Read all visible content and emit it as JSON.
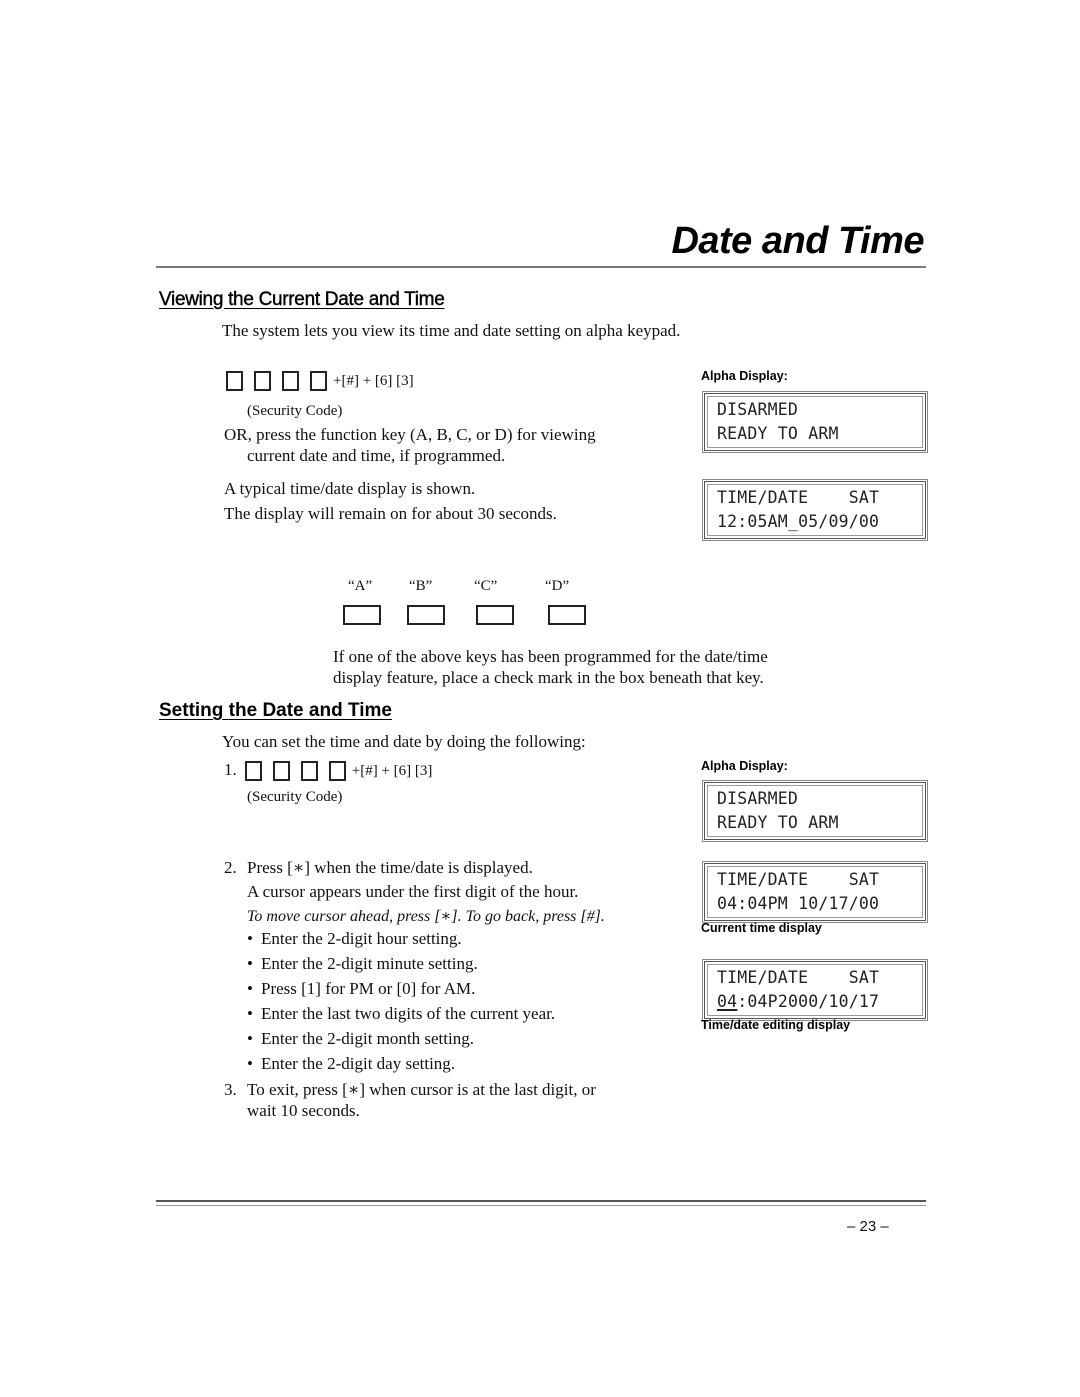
{
  "page": {
    "title": "Date and Time",
    "page_number": "– 23 –"
  },
  "viewing": {
    "heading": "Viewing the Current Date and Time",
    "intro": "The system lets you view its time and date setting on alpha keypad.",
    "key_sequence": "+[#] + [6] [3]",
    "security_code_label": "(Security Code)",
    "or_line_1": "OR, press the function key (A, B, C, or D) for viewing",
    "or_line_2": "current date and time, if programmed.",
    "typical_display": "A typical time/date display is shown.",
    "remain_on": "The display will remain on for about 30 seconds.",
    "function_keys": [
      {
        "label": "“A”",
        "checked": false
      },
      {
        "label": "“B”",
        "checked": false
      },
      {
        "label": "“C”",
        "checked": false
      },
      {
        "label": "“D”",
        "checked": false
      }
    ],
    "programmed_note_1": "If one of the above keys has been programmed for the date/time",
    "programmed_note_2": "display feature, place a check mark in the box beneath that key.",
    "alpha_display_label": "Alpha Display:",
    "displays": [
      {
        "line1": "DISARMED",
        "line2": "READY TO ARM"
      },
      {
        "line1": "TIME/DATE    SAT",
        "line2": "12:05AM_05/09/00"
      }
    ]
  },
  "setting": {
    "heading": "Setting the Date and Time",
    "intro": "You can set the time and date by doing the following:",
    "step1_number": "1.",
    "step1_sequence": "+[#] +  [6] [3]",
    "security_code_label": "(Security Code)",
    "step2_number": "2.",
    "step2_text": "Press [∗] when the time/date is displayed.",
    "step2_cursor": "A cursor appears under the first digit of the hour.",
    "step2_hint": "To move cursor ahead, press [∗]. To go back, press [#].",
    "bullets": [
      "Enter the 2-digit hour setting.",
      "Enter the 2-digit minute setting.",
      "Press [1] for PM or [0] for AM.",
      "Enter the last two digits of the current year.",
      "Enter the 2-digit month setting.",
      "Enter the 2-digit day setting."
    ],
    "step3_number": "3.",
    "step3_line1": "To exit, press [∗] when cursor is at the last digit, or",
    "step3_line2": "wait 10 seconds.",
    "alpha_display_label": "Alpha Display:",
    "displays": [
      {
        "line1": "DISARMED",
        "line2": "READY TO ARM"
      },
      {
        "line1": "TIME/DATE    SAT",
        "line2": "04:04PM 10/17/00",
        "caption": "Current time display"
      },
      {
        "line1": "TIME/DATE    SAT",
        "line2_cursor": "04",
        "line2_rest": ":04P2000/10/17",
        "caption": "Time/date editing display"
      }
    ]
  }
}
